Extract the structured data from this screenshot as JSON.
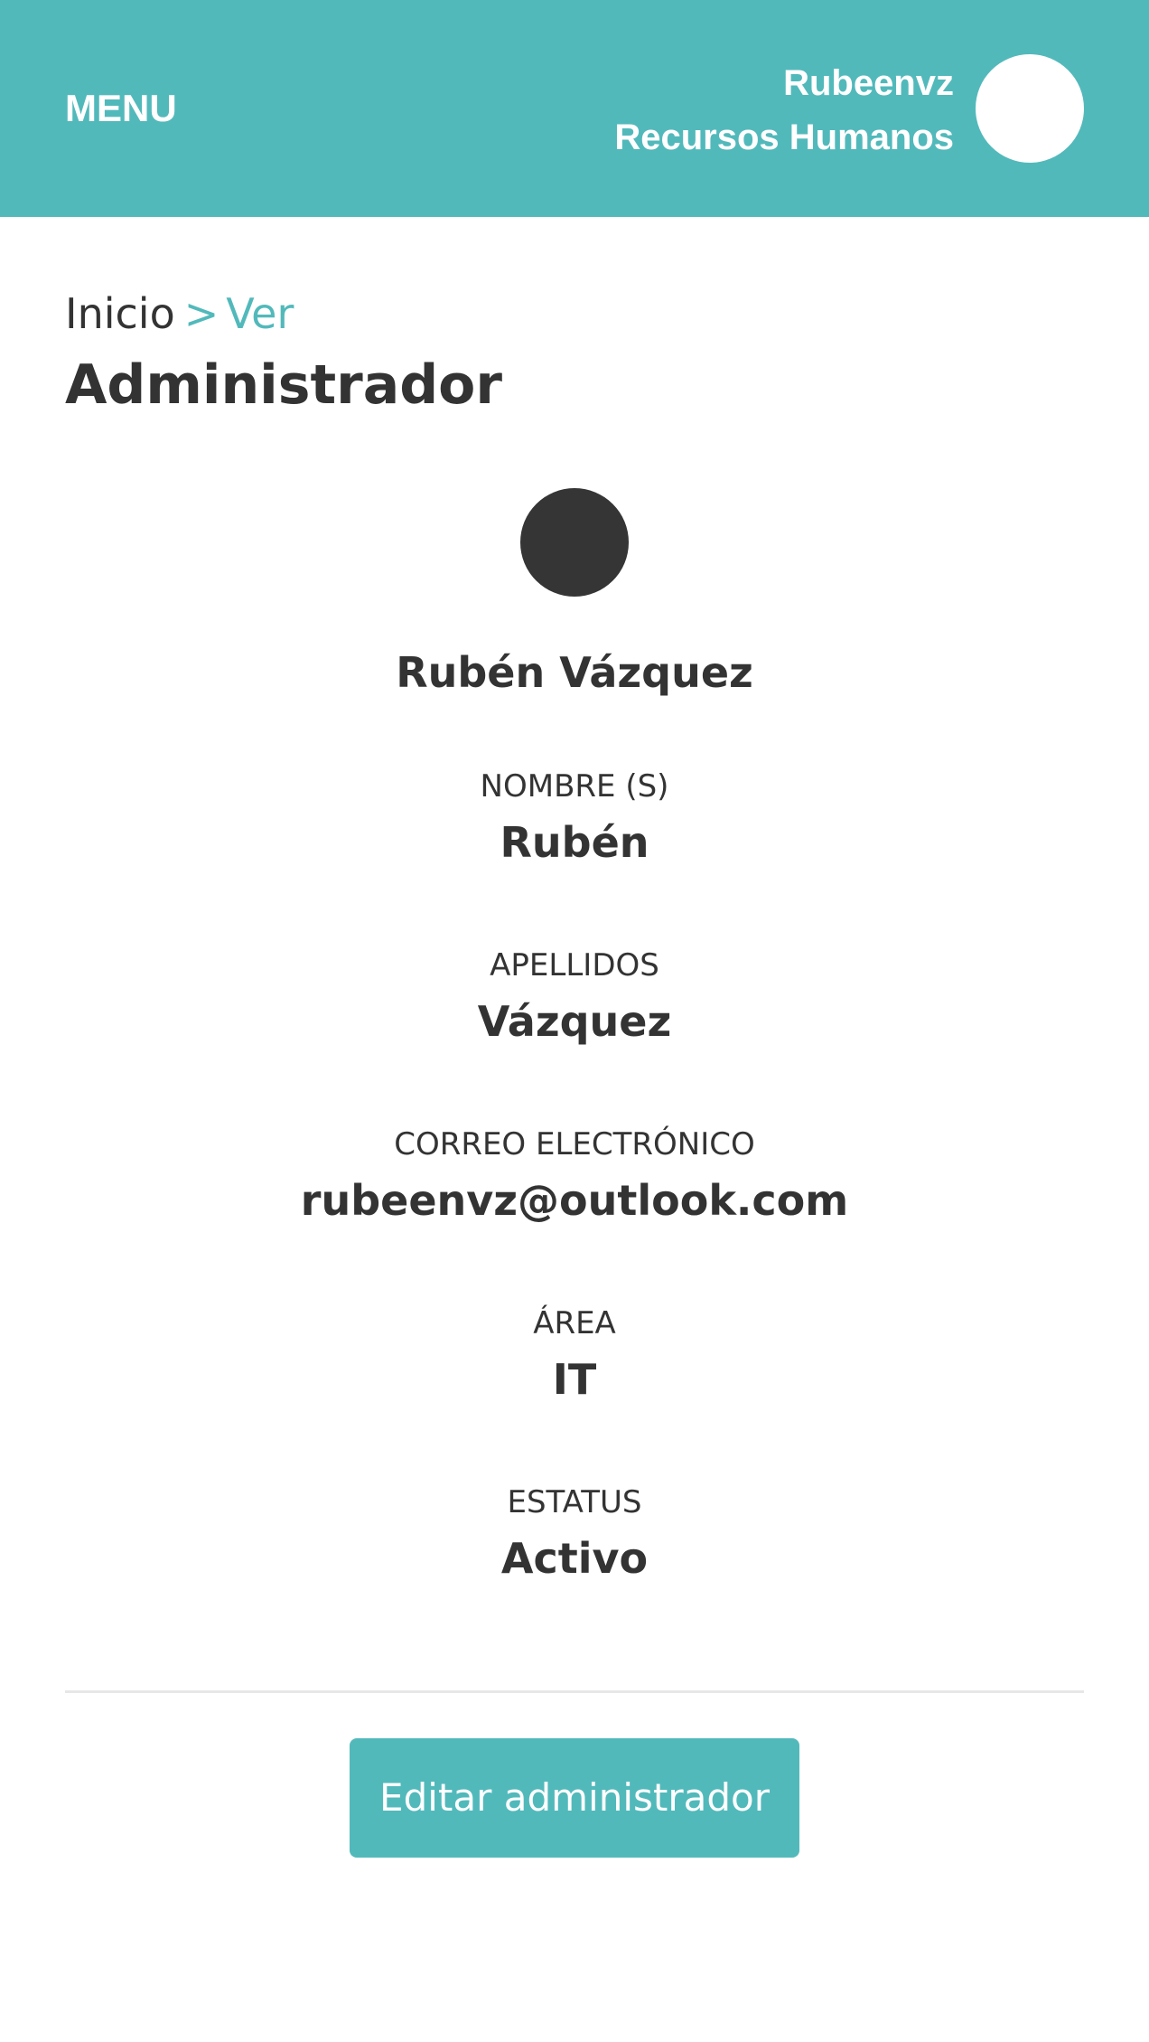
{
  "colors": {
    "accent": "#52b9bb",
    "text": "#333333",
    "background": "#ffffff",
    "divider": "#e7e7e7",
    "profile_avatar": "#353535"
  },
  "header": {
    "menu_label": "MENU",
    "user_name": "Rubeenvz",
    "user_department": "Recursos Humanos",
    "avatar_icon": "user-avatar-icon"
  },
  "breadcrumb": {
    "home": "Inicio",
    "separator": ">",
    "current": "Ver"
  },
  "page": {
    "title": "Administrador"
  },
  "profile": {
    "avatar_icon": "profile-avatar-icon",
    "full_name": "Rubén Vázquez",
    "fields": [
      {
        "label": "NOMBRE (S)",
        "value": "Rubén"
      },
      {
        "label": "APELLIDOS",
        "value": "Vázquez"
      },
      {
        "label": "CORREO ELECTRÓNICO",
        "value": "rubeenvz@outlook.com"
      },
      {
        "label": "ÁREA",
        "value": "IT"
      },
      {
        "label": "ESTATUS",
        "value": "Activo"
      }
    ]
  },
  "actions": {
    "edit_label": "Editar administrador"
  }
}
